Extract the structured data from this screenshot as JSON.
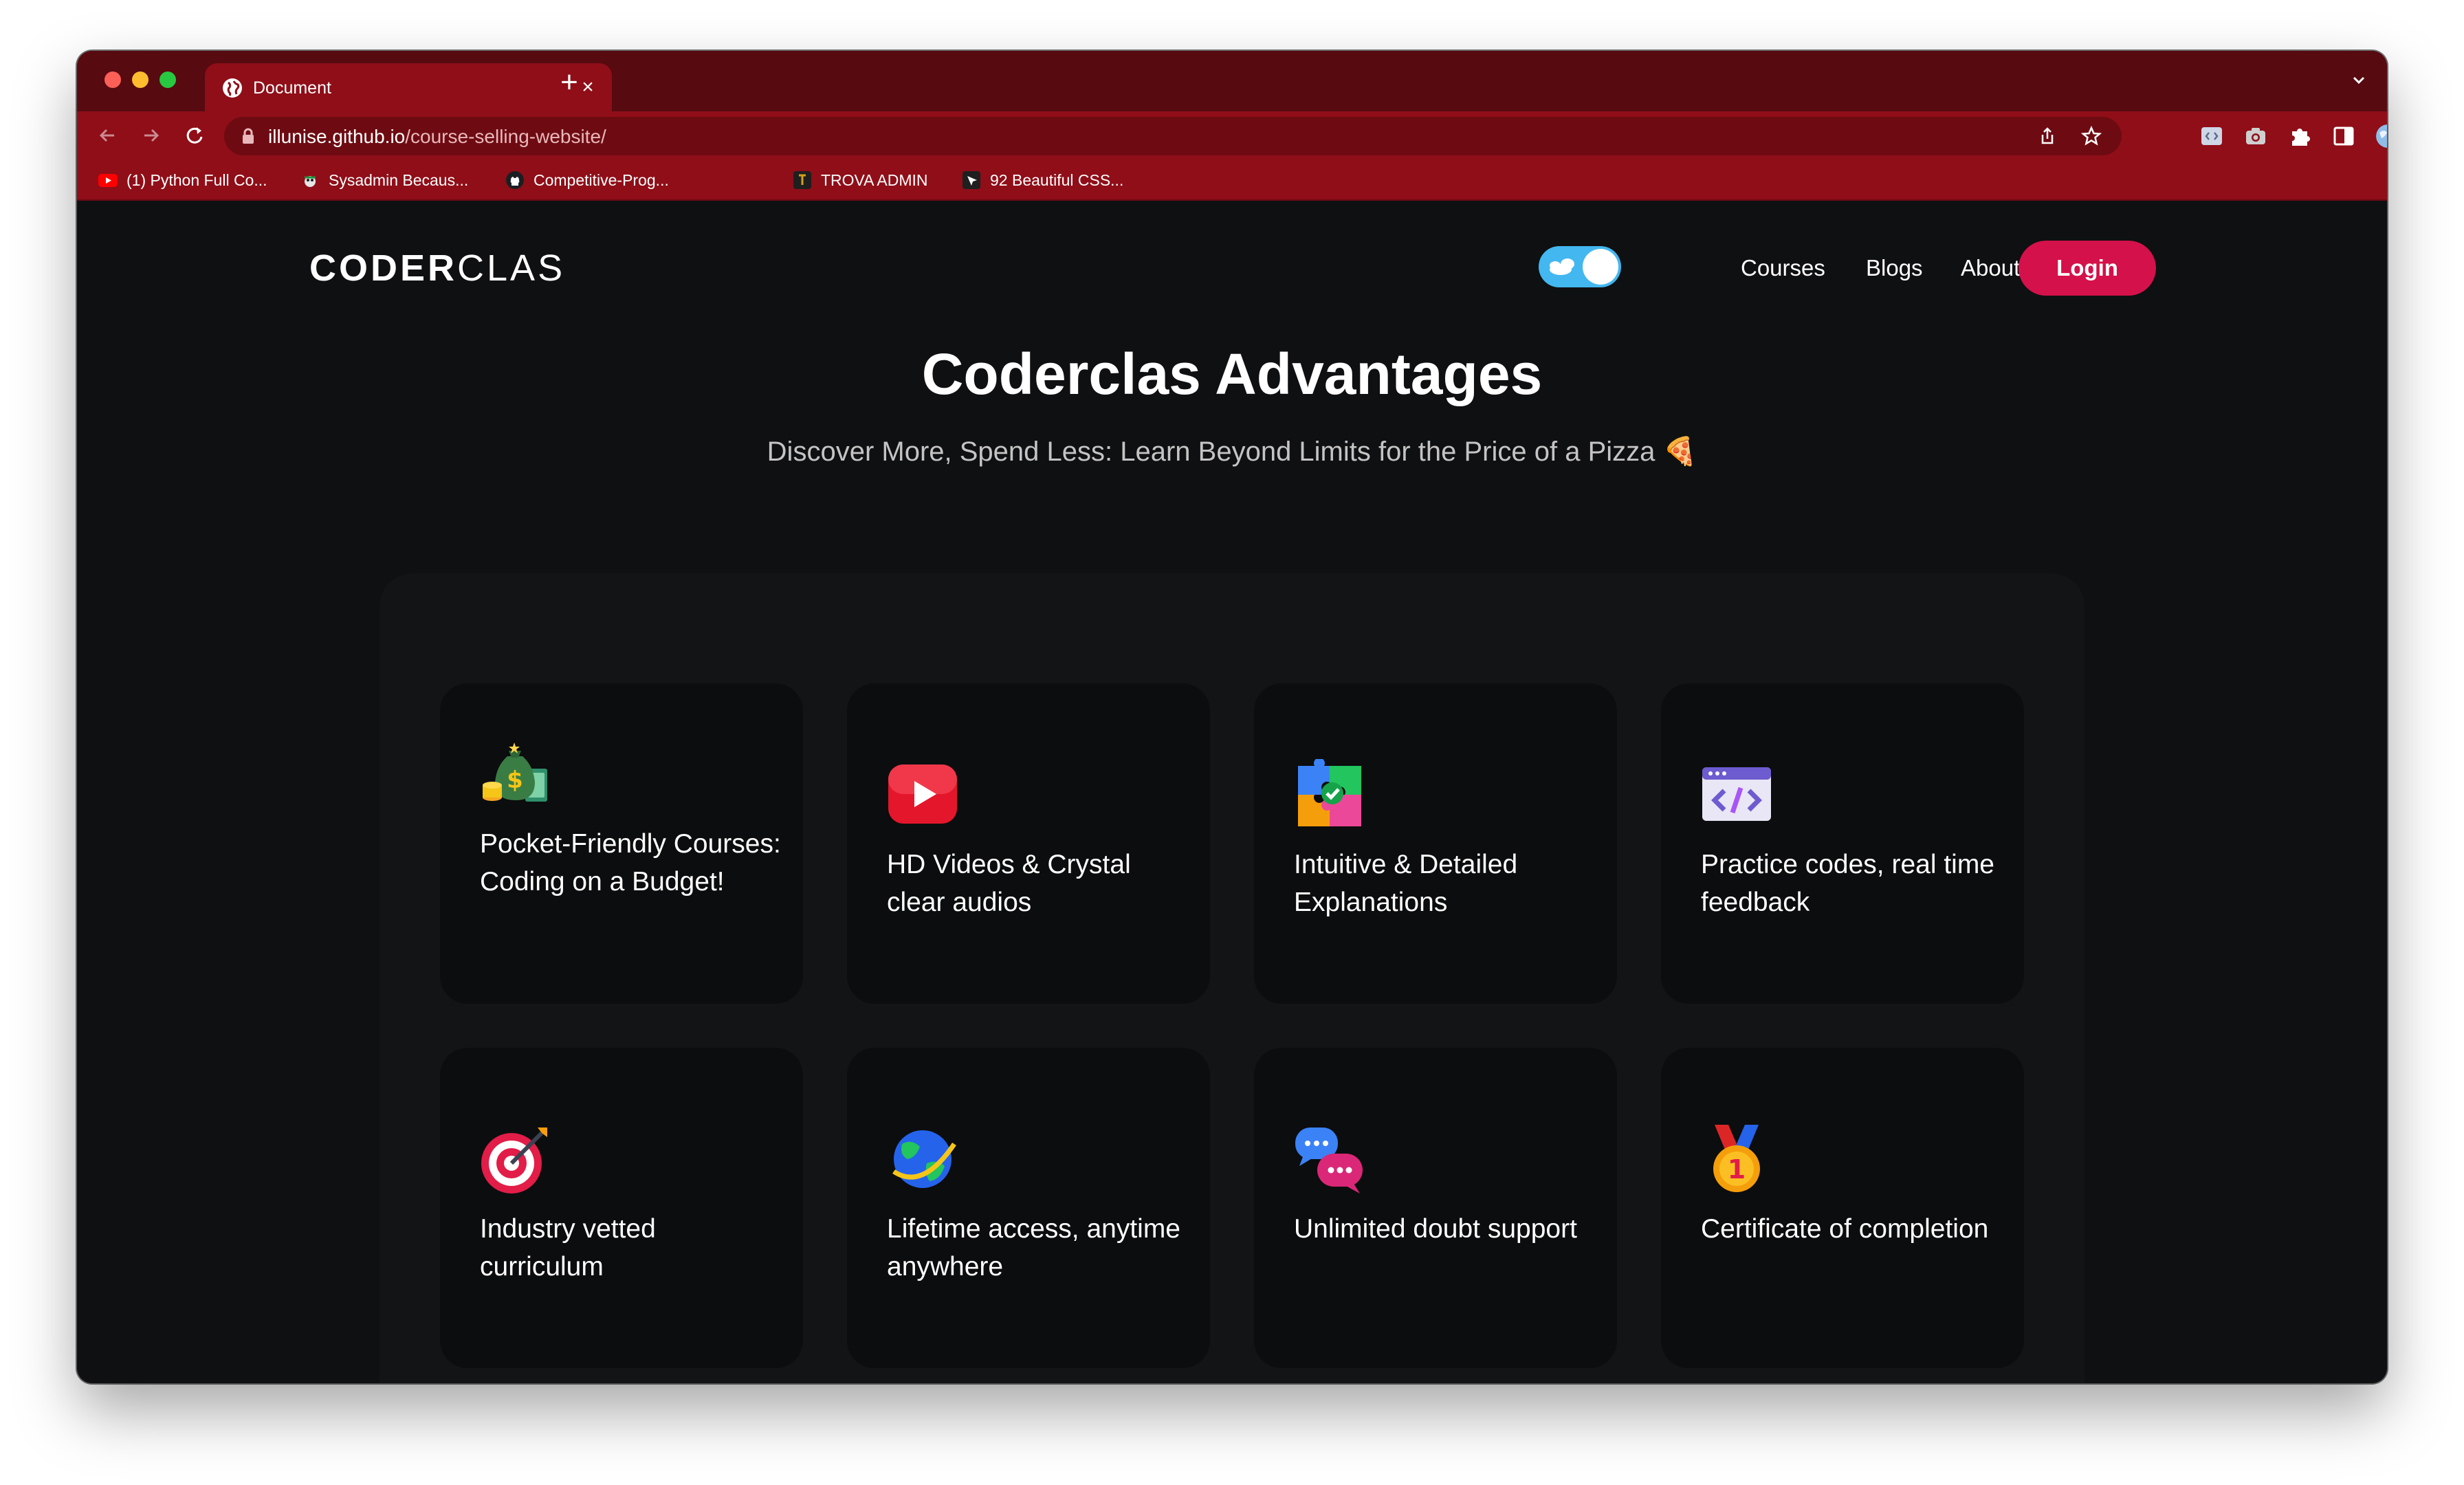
{
  "browser": {
    "tab": {
      "title": "Document",
      "close_glyph": "×"
    },
    "new_tab_glyph": "+",
    "url": {
      "host": "illunise.github.io",
      "path": "/course-selling-website/"
    },
    "bookmarks": [
      {
        "label": "(1) Python Full Co...",
        "icon": "youtube-icon",
        "color": "#ff0000"
      },
      {
        "label": "Sysadmin Becaus...",
        "icon": "sysadmin-icon",
        "color": "#e6e6e6"
      },
      {
        "label": "Competitive-Prog...",
        "icon": "github-icon",
        "color": "#1b1f23"
      },
      {
        "label": "TROVA ADMIN",
        "icon": "trova-icon",
        "color": "#1f1f1f"
      },
      {
        "label": "92 Beautiful CSS...",
        "icon": "css-icon",
        "color": "#1f1f1f"
      }
    ]
  },
  "site": {
    "logo": {
      "bold": "CODER",
      "light": "CLAS"
    },
    "theme_toggle": {
      "state": "on",
      "color": "#43b7f0"
    },
    "nav": [
      {
        "label": "Courses"
      },
      {
        "label": "Blogs"
      },
      {
        "label": "About Us"
      }
    ],
    "login_label": "Login",
    "accent": "#d4114a"
  },
  "hero": {
    "title": "Coderclas Advantages",
    "subtitle": "Discover More, Spend Less: Learn Beyond Limits for the Price of a Pizza 🍕"
  },
  "advantages": [
    {
      "icon": "money-bag-icon",
      "text": "Pocket-Friendly Courses: Coding on a Budget!"
    },
    {
      "icon": "play-video-icon",
      "text": "HD Videos & Crystal clear audios"
    },
    {
      "icon": "puzzle-icon",
      "text": "Intuitive & Detailed Explanations"
    },
    {
      "icon": "code-window-icon",
      "text": "Practice codes, real time feedback"
    },
    {
      "icon": "target-icon",
      "text": "Industry vetted curriculum"
    },
    {
      "icon": "planet-icon",
      "text": "Lifetime access, anytime anywhere"
    },
    {
      "icon": "chat-bubbles-icon",
      "text": "Unlimited doubt support"
    },
    {
      "icon": "medal-icon",
      "text": "Certificate of completion"
    }
  ]
}
